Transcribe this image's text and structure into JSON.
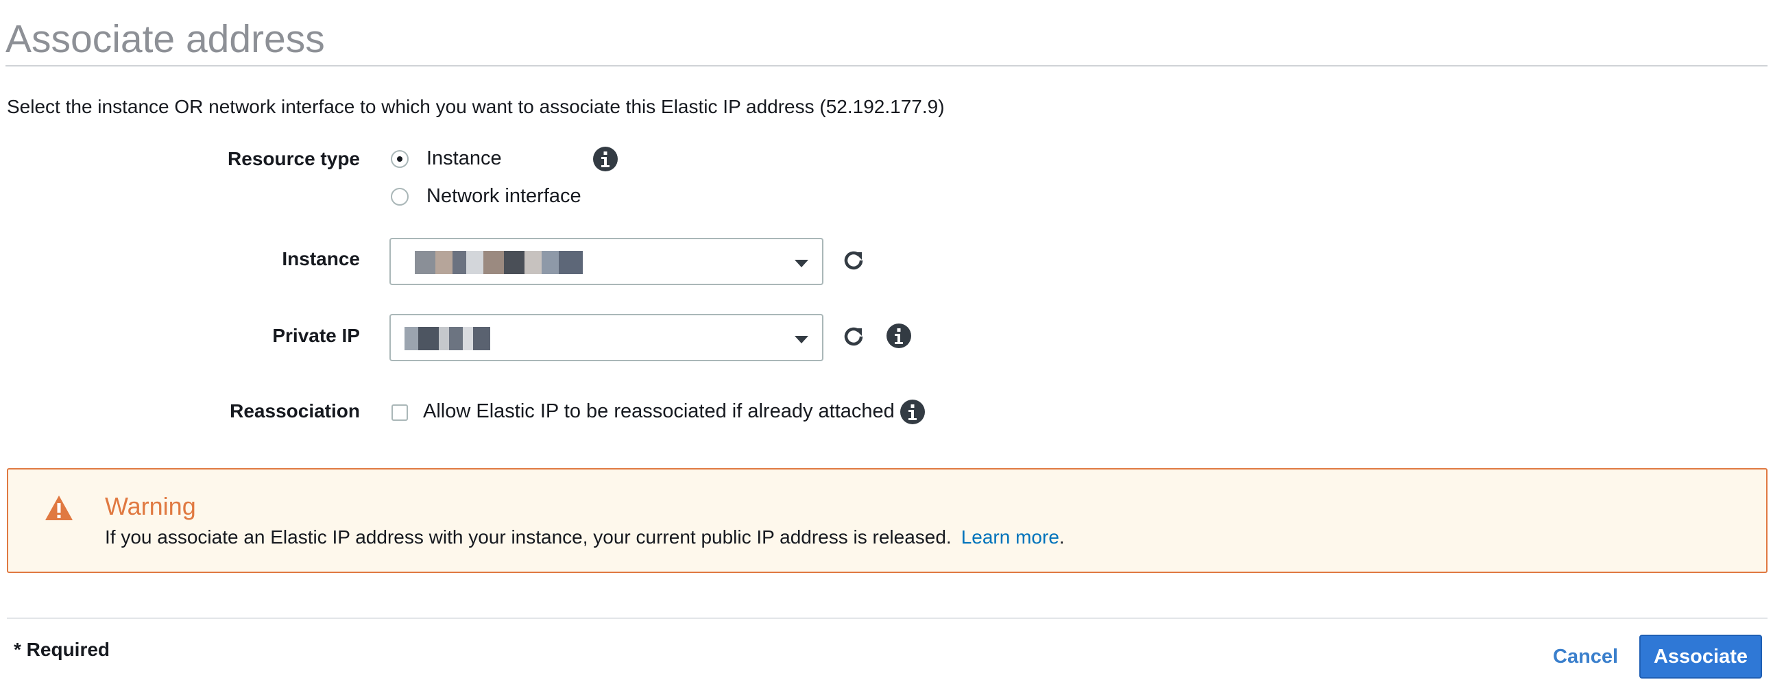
{
  "page": {
    "title": "Associate address",
    "description": "Select the instance OR network interface to which you want to associate this Elastic IP address (52.192.177.9)"
  },
  "form": {
    "resource_type": {
      "label": "Resource type",
      "options": [
        "Instance",
        "Network interface"
      ],
      "selected": "Instance"
    },
    "instance": {
      "label": "Instance",
      "value": "(obscured)"
    },
    "private_ip": {
      "label": "Private IP",
      "value": "(obscured)"
    },
    "reassociation": {
      "label": "Reassociation",
      "checkbox_label": "Allow Elastic IP to be reassociated if already attached",
      "checked": false
    }
  },
  "warning": {
    "title": "Warning",
    "message": "If you associate an Elastic IP address with your instance, your current public IP address is released.",
    "link_text": "Learn more",
    "trailing": "."
  },
  "footer": {
    "required_note": "* Required",
    "cancel_label": "Cancel",
    "submit_label": "Associate"
  },
  "colors": {
    "accent": "#2f78d6",
    "warning": "#e07941",
    "warning_bg": "#fef8ec",
    "link": "#0073bb"
  }
}
